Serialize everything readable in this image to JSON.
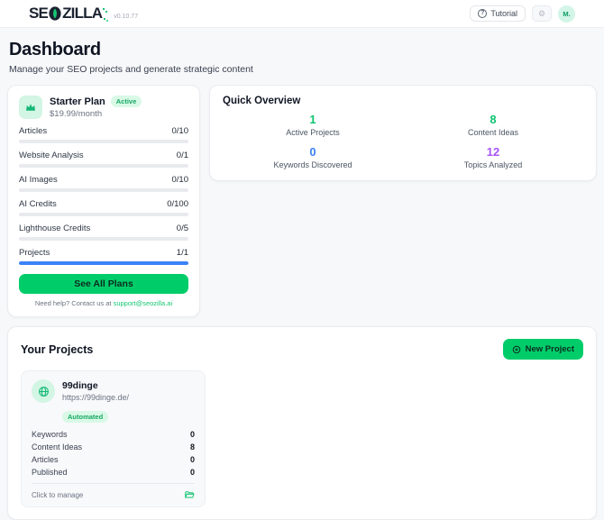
{
  "colors": {
    "brand_green": "#00cd6a",
    "button_text_dark": "#0a2d1e",
    "stat_green": "#0cc56e",
    "stat_blue": "#3b82f6",
    "stat_purple": "#a855f7",
    "progress_fill": "#3b82f6",
    "badge_bg": "#d9f9e6",
    "badge_text": "#16a863",
    "mint_bg": "#d3f5e4",
    "icon_green": "#14b877",
    "link_green": "#16c673",
    "avatar_bg": "#d2f5e8",
    "avatar_text": "#0f9d63"
  },
  "header": {
    "logo_pre": "SE",
    "logo_post": "ZILLA",
    "version": "v0.10.77",
    "tutorial_label": "Tutorial",
    "help_glyph": "?",
    "gear_glyph": "⚙",
    "avatar_initials": "M."
  },
  "page": {
    "title": "Dashboard",
    "subtitle": "Manage your SEO projects and generate strategic content"
  },
  "plan": {
    "name": "Starter Plan",
    "status_badge": "Active",
    "price": "$19.99/month",
    "usage": [
      {
        "label": "Articles",
        "value": "0/10",
        "percent": 0
      },
      {
        "label": "Website Analysis",
        "value": "0/1",
        "percent": 0
      },
      {
        "label": "AI Images",
        "value": "0/10",
        "percent": 0
      },
      {
        "label": "AI Credits",
        "value": "0/100",
        "percent": 0
      },
      {
        "label": "Lighthouse Credits",
        "value": "0/5",
        "percent": 0
      },
      {
        "label": "Projects",
        "value": "1/1",
        "percent": 100
      }
    ],
    "cta_label": "See All Plans",
    "support_text": "Need help? Contact us at ",
    "support_email": "support@seozilla.ai"
  },
  "quick_overview": {
    "title": "Quick Overview",
    "stats": [
      {
        "value": "1",
        "label": "Active Projects",
        "color": "#0cc56e"
      },
      {
        "value": "8",
        "label": "Content Ideas",
        "color": "#0cc56e"
      },
      {
        "value": "0",
        "label": "Keywords Discovered",
        "color": "#3b82f6"
      },
      {
        "value": "12",
        "label": "Topics Analyzed",
        "color": "#a855f7"
      }
    ]
  },
  "projects": {
    "title": "Your Projects",
    "new_project_label": "New Project",
    "cards": [
      {
        "name": "99dinge",
        "url": "https://99dinge.de/",
        "badge": "Automated",
        "stats": [
          {
            "label": "Keywords",
            "value": "0"
          },
          {
            "label": "Content Ideas",
            "value": "8"
          },
          {
            "label": "Articles",
            "value": "0"
          },
          {
            "label": "Published",
            "value": "0"
          }
        ],
        "footer": "Click to manage"
      }
    ]
  }
}
